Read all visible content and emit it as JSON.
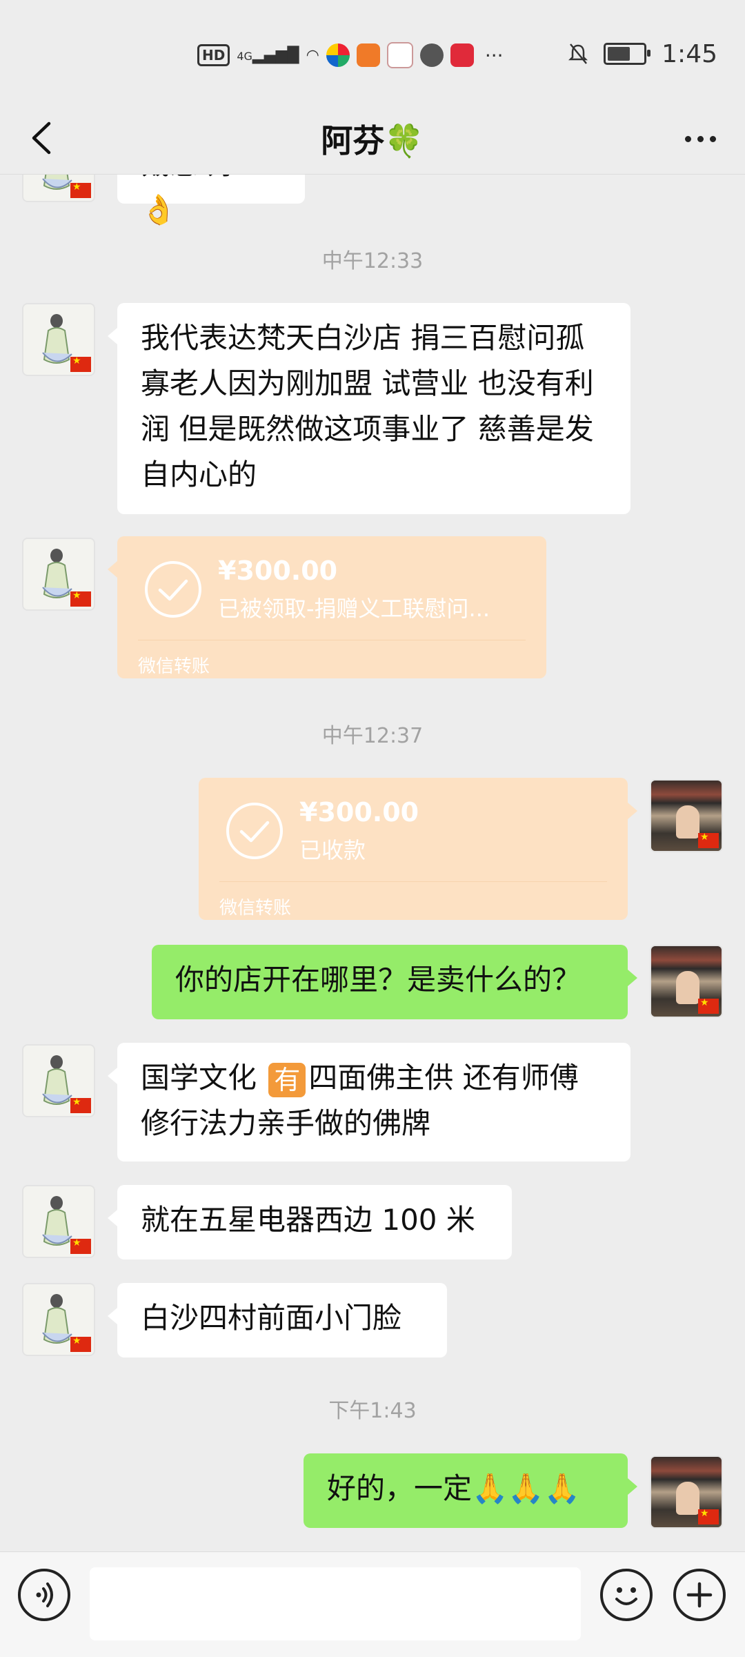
{
  "status_bar": {
    "hd_label": "HD",
    "network": "4G",
    "time": "1:45"
  },
  "header": {
    "title": "阿芬",
    "title_emoji": "🍀"
  },
  "messages": {
    "partial_top": "戴您 好 👌",
    "ts1": "中午12:33",
    "msg1": "我代表达梵天白沙店 捐三百慰问孤寡老人因为刚加盟 试营业 也没有利润 但是既然做这项事业了 慈善是发自内心的",
    "transfer1": {
      "amount": "¥300.00",
      "desc": "已被领取-捐赠义工联慰问...",
      "footer": "微信转账"
    },
    "ts2": "中午12:37",
    "transfer2": {
      "amount": "¥300.00",
      "desc": "已收款",
      "footer": "微信转账"
    },
    "msg_me1": "你的店开在哪里？是卖什么的？",
    "msg2_part1": "国学文化",
    "msg2_emoji": "有",
    "msg2_part2": "四面佛主供 还有师傅修行法力亲手做的佛牌",
    "msg3": "就在五星电器西边 100 米",
    "msg4": "白沙四村前面小门脸",
    "ts3": "下午1:43",
    "msg_me2": "好的，一定🙏🙏🙏"
  },
  "input": {
    "placeholder": ""
  },
  "colors": {
    "background": "#ededed",
    "my_bubble": "#95ec69",
    "transfer_card": "#fde1c3"
  }
}
